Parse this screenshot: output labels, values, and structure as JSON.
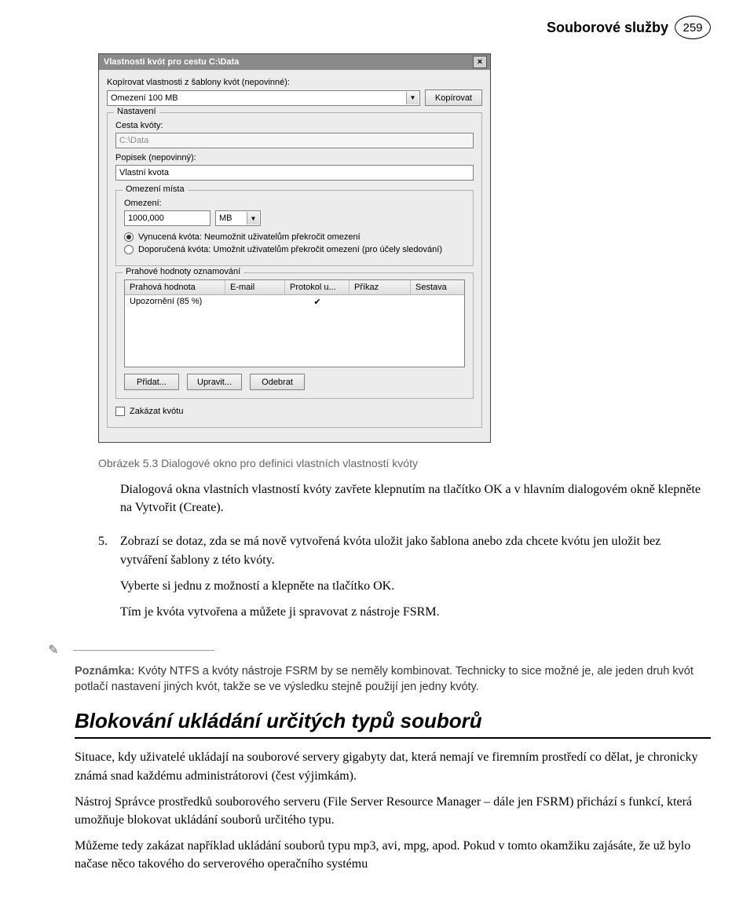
{
  "header": {
    "section": "Souborové služby",
    "page": "259"
  },
  "dialog": {
    "title": "Vlastnosti kvót pro cestu C:\\Data",
    "copy_template_label": "Kopírovat vlastnosti z šablony kvót (nepovinné):",
    "copy_template_value": "Omezení 100 MB",
    "copy_button": "Kopírovat",
    "settings": {
      "legend": "Nastavení",
      "path_label": "Cesta kvóty:",
      "path_value": "C:\\Data",
      "desc_label": "Popisek (nepovinný):",
      "desc_value": "Vlastní kvota"
    },
    "limit": {
      "legend": "Omezení místa",
      "label": "Omezení:",
      "value": "1000,000",
      "unit": "MB",
      "radio_hard": "Vynucená kvóta: Neumožnit uživatelům překročit omezení",
      "radio_soft": "Doporučená kvóta: Umožnit uživatelům překročit omezení (pro účely sledování)"
    },
    "thresholds": {
      "legend": "Prahové hodnoty oznamování",
      "headers": {
        "c1": "Prahová hodnota",
        "c2": "E-mail",
        "c3": "Protokol u...",
        "c4": "Příkaz",
        "c5": "Sestava"
      },
      "rows": [
        {
          "c1": "Upozornění (85 %)",
          "c2": "",
          "c3": "✔",
          "c4": "",
          "c5": ""
        }
      ],
      "add": "Přidat...",
      "edit": "Upravit...",
      "remove": "Odebrat"
    },
    "disable_label": "Zakázat kvótu"
  },
  "caption": "Obrázek 5.3 Dialogové okno pro definici vlastních vlastností kvóty",
  "body": {
    "p1": "Dialogová okna vlastních vlastností kvóty zavřete klepnutím na tlačítko OK a v hlavním dialogovém okně klepněte na Vytvořit (Create).",
    "li5_num": "5.",
    "li5_a": "Zobrazí se dotaz, zda se má nově vytvořená kvóta uložit jako šablona anebo zda chcete kvótu jen uložit bez vytváření šablony z této kvóty.",
    "li5_b": "Vyberte si jednu z možností a klepněte na tlačítko OK.",
    "li5_c": "Tím je kvóta vytvořena a můžete ji spravovat z nástroje FSRM.",
    "note_label": "Poznámka:",
    "note_text": " Kvóty NTFS a kvóty nástroje FSRM by se neměly kombinovat. Technicky to sice možné je, ale jeden druh kvót potlačí nastavení jiných kvót, takže se ve výsledku stejně použijí jen jedny kvóty.",
    "h2": "Blokování ukládání určitých typů souborů",
    "p2": "Situace, kdy uživatelé ukládají na souborové servery gigabyty dat, která nemají ve firemním prostředí co dělat, je chronicky známá snad každému administrátorovi (čest výjimkám).",
    "p3": "Nástroj Správce prostředků souborového serveru (File Server Resource Manager – dále jen FSRM) přichází s funkcí, která umožňuje blokovat ukládání souborů určitého typu.",
    "p4": "Můžeme tedy zakázat například ukládání souborů typu mp3, avi, mpg, apod. Pokud v tomto okamžiku zajásáte, že už bylo načase něco takového do serverového operačního systému"
  }
}
